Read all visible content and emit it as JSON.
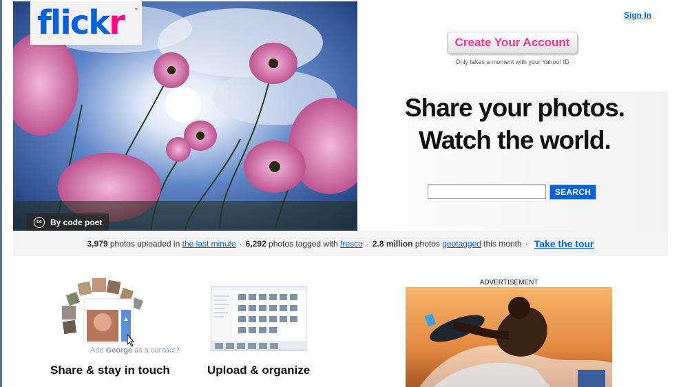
{
  "brand": {
    "logo_part1": "flick",
    "logo_part2": "r",
    "trademark": "™"
  },
  "hero": {
    "credit": "By code poet",
    "cc_icon": "cc"
  },
  "header": {
    "sign_in": "Sign In"
  },
  "cta": {
    "create_account": "Create Your Account",
    "subtext": "Only takes a moment with your Yahoo! ID"
  },
  "tagline": {
    "line1": "Share your photos.",
    "line2": "Watch the world."
  },
  "search": {
    "value": "",
    "button": "SEARCH"
  },
  "stats": {
    "uploaded_count": "3,979",
    "uploaded_text": "photos uploaded in",
    "uploaded_link": "the last minute",
    "tagged_count": "6,292",
    "tagged_text": "photos tagged with",
    "tagged_link": "fresco",
    "geo_count": "2.8 million",
    "geo_text": "photos",
    "geo_link": "geotagged",
    "geo_suffix": "this month",
    "tour_link": "Take the tour",
    "separator": "·"
  },
  "features": {
    "share_title": "Share & stay in touch",
    "upload_title": "Upload & organize",
    "contact_prefix": "Add",
    "contact_name": "George",
    "contact_suffix": "as a contact?"
  },
  "ad": {
    "label": "ADVERTISEMENT"
  },
  "colors": {
    "brand_blue": "#0063dc",
    "brand_pink": "#ff0084",
    "cta_pink": "#ff3399"
  }
}
